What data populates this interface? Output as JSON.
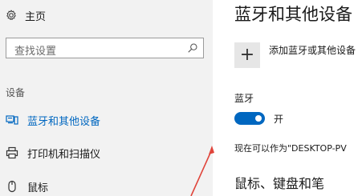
{
  "sidebar": {
    "home_label": "主页",
    "search_placeholder": "查找设置",
    "section_header": "设备",
    "items": [
      {
        "label": "蓝牙和其他设备",
        "icon": "bluetooth-devices-icon",
        "active": true
      },
      {
        "label": "打印机和扫描仪",
        "icon": "printer-icon",
        "active": false
      },
      {
        "label": "鼠标",
        "icon": "mouse-icon",
        "active": false
      }
    ]
  },
  "main": {
    "title": "蓝牙和其他设备",
    "add_device_label": "添加蓝牙或其他设备",
    "bluetooth_label": "蓝牙",
    "toggle_state": "开",
    "discoverable_text": "现在可以作为\"DESKTOP-PV",
    "section2_title": "鼠标、键盘和笔"
  },
  "colors": {
    "accent": "#0067c0",
    "sidebar_bg": "#f2f2f2",
    "annotation_arrow": "#e0443a"
  }
}
